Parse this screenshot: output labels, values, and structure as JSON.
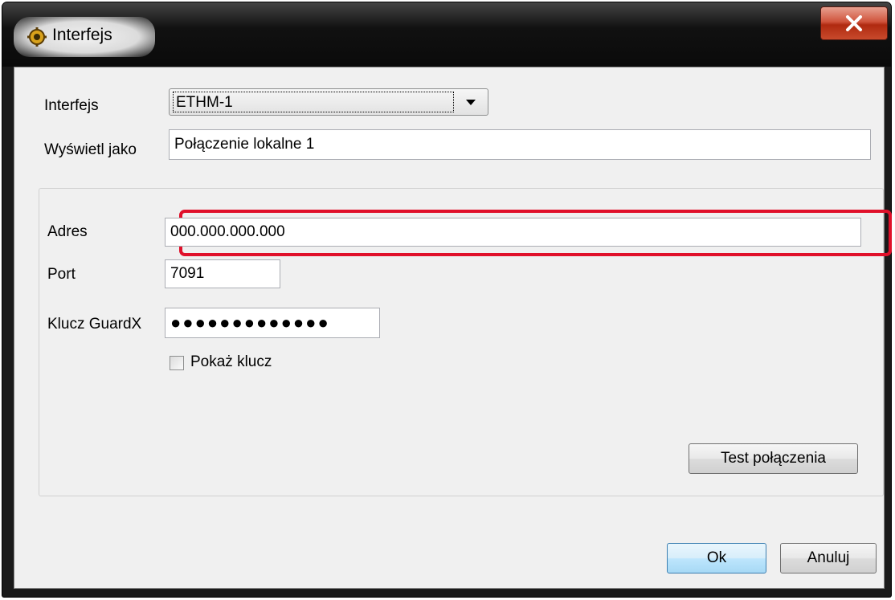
{
  "window": {
    "title": "Interfejs",
    "close_label": "X"
  },
  "form": {
    "interface_label": "Interfejs",
    "interface_value": "ETHM-1",
    "display_as_label": "Wyświetl jako",
    "display_as_value": "Połączenie lokalne 1"
  },
  "connection": {
    "address_label": "Adres",
    "address_value": "000.000.000.000",
    "port_label": "Port",
    "port_value": "7091",
    "key_label": "Klucz GuardX",
    "key_value": "●●●●●●●●●●●●●",
    "show_key_label": "Pokaż klucz",
    "show_key_checked": false,
    "test_button": "Test połączenia"
  },
  "buttons": {
    "ok": "Ok",
    "cancel": "Anuluj"
  },
  "colors": {
    "highlight": "#e0102a",
    "default_button": "#a7d9f5"
  },
  "icons": {
    "title": "gear-icon",
    "close": "close-icon",
    "dropdown": "chevron-down-icon"
  }
}
